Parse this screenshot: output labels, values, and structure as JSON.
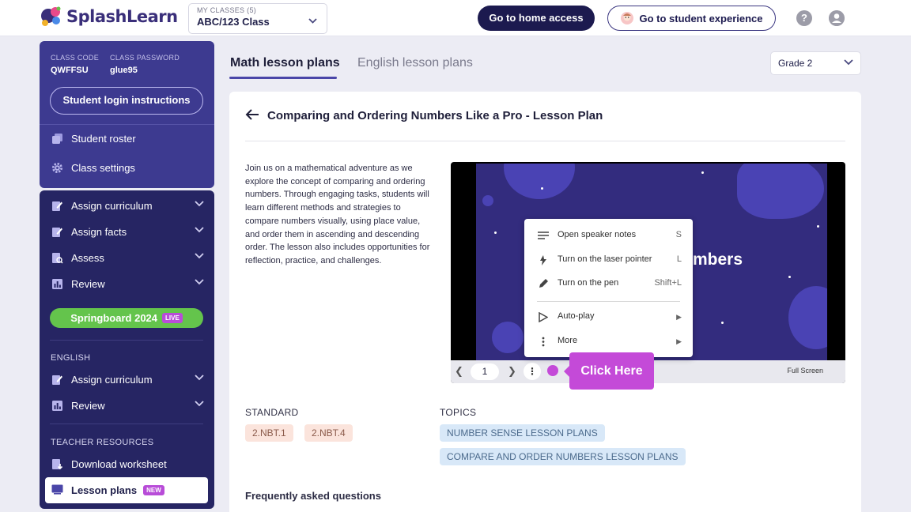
{
  "header": {
    "logo_text": "SplashLearn",
    "class_selector": {
      "label": "MY CLASSES (5)",
      "value": "ABC/123 Class"
    },
    "home_access_label": "Go to home access",
    "student_experience_label": "Go to student experience",
    "help_glyph": "?"
  },
  "sidebar": {
    "class_code_label": "CLASS CODE",
    "class_code": "QWFFSU",
    "class_password_label": "CLASS PASSWORD",
    "class_password": "glue95",
    "login_instructions_label": "Student login instructions",
    "top_items": [
      {
        "label": "Student roster",
        "icon": "roster-icon"
      },
      {
        "label": "Class settings",
        "icon": "gear-icon"
      }
    ],
    "math_items": [
      {
        "label": "Assign curriculum",
        "icon": "assign-icon"
      },
      {
        "label": "Assign facts",
        "icon": "assign-icon"
      },
      {
        "label": "Assess",
        "icon": "assess-icon"
      },
      {
        "label": "Review",
        "icon": "review-icon"
      }
    ],
    "springboard_label": "Springboard 2024",
    "springboard_badge": "LIVE",
    "english_heading": "ENGLISH",
    "english_items": [
      {
        "label": "Assign curriculum",
        "icon": "assign-icon"
      },
      {
        "label": "Review",
        "icon": "review-icon"
      }
    ],
    "teacher_resources_heading": "TEACHER RESOURCES",
    "download_worksheet_label": "Download worksheet",
    "lesson_plans_label": "Lesson plans",
    "lesson_plans_badge": "NEW"
  },
  "tabs": {
    "math_label": "Math lesson plans",
    "english_label": "English lesson plans",
    "active": "math"
  },
  "grade_selector": {
    "value": "Grade 2"
  },
  "lesson": {
    "title": "Comparing and Ordering Numbers Like a Pro - Lesson Plan",
    "description": "Join us on a mathematical adventure as we explore the concept of comparing and ordering numbers. Through engaging tasks, students will learn different methods and strategies to compare numbers visually, using place value, and order them in ascending and descending order. The lesson also includes opportunities for reflection, practice, and challenges.",
    "slide": {
      "visible_title": "Numbers",
      "page_number": "1",
      "full_screen_label": "Full Screen",
      "context_menu": [
        {
          "label": "Open speaker notes",
          "shortcut": "S",
          "icon": "notes-icon"
        },
        {
          "label": "Turn on the laser pointer",
          "shortcut": "L",
          "icon": "laser-pointer-icon"
        },
        {
          "label": "Turn on the pen",
          "shortcut": "Shift+L",
          "icon": "pen-icon"
        },
        {
          "label": "Auto-play",
          "shortcut": "▶",
          "icon": "play-icon"
        },
        {
          "label": "More",
          "shortcut": "▶",
          "icon": "more-vertical-icon"
        }
      ]
    },
    "callout_label": "Click Here",
    "standard_heading": "STANDARD",
    "standards": [
      "2.NBT.1",
      "2.NBT.4"
    ],
    "topics_heading": "TOPICS",
    "topics": [
      "NUMBER SENSE LESSON PLANS",
      "COMPARE AND ORDER NUMBERS LESSON PLANS"
    ],
    "faq_heading": "Frequently asked questions"
  },
  "colors": {
    "brand_dark": "#1c1a4f",
    "sidebar_top": "#3d3a90",
    "sidebar_bottom": "#262563",
    "springboard_green": "#64c44c",
    "callout_purple": "#c44ad8"
  }
}
